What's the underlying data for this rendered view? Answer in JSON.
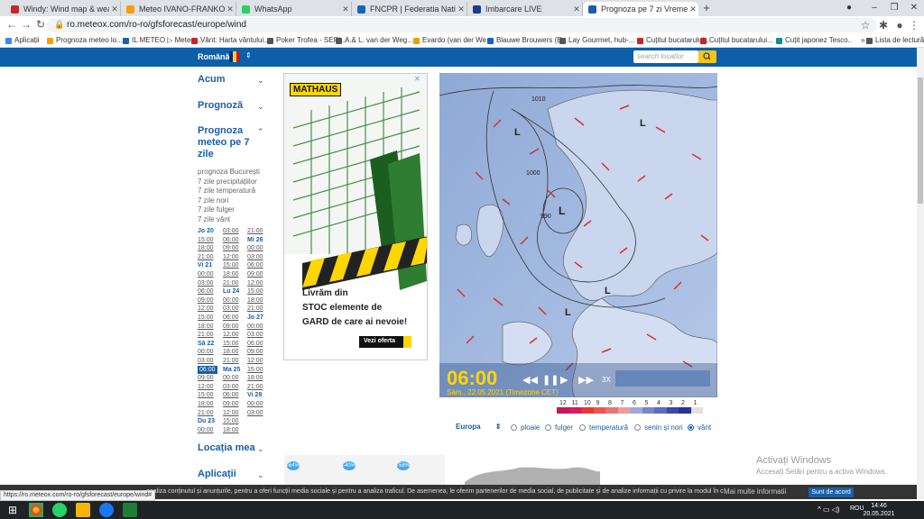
{
  "browser": {
    "tabs": [
      {
        "label": "Windy: Wind map & weather fo",
        "color": "#c62828",
        "active": false
      },
      {
        "label": "Meteo IVANO-FRANKOVSK (Ucra",
        "color": "#f59f00",
        "active": false
      },
      {
        "label": "WhatsApp",
        "color": "#25d366",
        "active": false
      },
      {
        "label": "FNCPR | Federatia Nationala a Cr",
        "color": "#1565c0",
        "active": false
      },
      {
        "label": "Imbarcare LIVE",
        "color": "#1e3a8a",
        "active": false
      },
      {
        "label": "Prognoza pe 7 zi Vremea Vânt p",
        "color": "#1a5ea8",
        "active": true
      }
    ],
    "url": "ro.meteox.com/ro-ro/gfsforecast/europe/wind",
    "bookmarks": [
      {
        "label": "Aplicații",
        "color": "#4285f4"
      },
      {
        "label": "Prognoza meteo lo...",
        "color": "#f59f00"
      },
      {
        "label": "IL METEO ▷ Meteo...",
        "color": "#1565c0"
      },
      {
        "label": "Vânt: Harta vântului...",
        "color": "#c62828"
      },
      {
        "label": "Poker Trofea - SERI...",
        "color": "#555555"
      },
      {
        "label": "A.& L. van der Weg...",
        "color": "#555555"
      },
      {
        "label": "Evardo (van der We...",
        "color": "#e8a000"
      },
      {
        "label": "Blauwe Brouwers (E...",
        "color": "#1565c0"
      },
      {
        "label": "Lay Gourmet, hub-...",
        "color": "#555555"
      },
      {
        "label": "Cuțitul bucatarului...",
        "color": "#c62828"
      },
      {
        "label": "Cuțitul bucatarului...",
        "color": "#c62828"
      },
      {
        "label": "Cuțit japonez Tesco...",
        "color": "#0d8f8f"
      },
      {
        "label": "»",
        "color": "#ffffff"
      },
      {
        "label": "Lista de lectură",
        "color": "#555555"
      }
    ]
  },
  "site": {
    "language": "Română",
    "search_placeholder": "search locatior",
    "sidebar": {
      "acum": "Acum",
      "prognoza": "Prognoză",
      "prognoza7_line1": "Prognoza",
      "prognoza7_line2": "meteo pe 7",
      "prognoza7_line3": "zile",
      "links": [
        "prognoza București",
        "7 zile precipitațiilor",
        "7 zile temperatură",
        "7 zile nori",
        "7 zile fulger",
        "7 zile vânt"
      ],
      "locatia": "Locația mea",
      "aplicatii": "Aplicații"
    },
    "hours": {
      "col1": [
        "Jo 20",
        "15:00",
        "18:00",
        "21:00",
        "Vi 21",
        "00:00",
        "03:00",
        "06:00",
        "09:00",
        "12:00",
        "15:00",
        "18:00",
        "21:00",
        "Sâ 22",
        "00:00",
        "03:00",
        "06:00",
        "09:00",
        "12:00",
        "15:00",
        "18:00",
        "21:00",
        "Du 23",
        "00:00"
      ],
      "col2": [
        "03:00",
        "06:00",
        "09:00",
        "12:00",
        "15:00",
        "18:00",
        "21:00",
        "Lu 24",
        "00:00",
        "03:00",
        "06:00",
        "09:00",
        "12:00",
        "15:00",
        "18:00",
        "21:00",
        "Ma 25",
        "00:00",
        "03:00",
        "06:00",
        "09:00",
        "12:00",
        "15:00",
        "18:00"
      ],
      "col3": [
        "21:00",
        "Mi 26",
        "00:00",
        "03:00",
        "06:00",
        "09:00",
        "12:00",
        "15:00",
        "18:00",
        "21:00",
        "Jo 27",
        "00:00",
        "03:00",
        "06:00",
        "09:00",
        "12:00",
        "15:00",
        "18:00",
        "21:00",
        "Vi 28",
        "00:00",
        "03:00",
        "",
        ""
      ],
      "selected": "06:00"
    },
    "ad": {
      "brand": "MATHAUS",
      "text_line1": "Livrăm din",
      "text_line2": "STOC elemente de",
      "text_line3": "GARD de care ai nevoie!",
      "cta": "Vezi oferta"
    },
    "map": {
      "time": "06:00",
      "date_line": "Sâm., 22.05.2021 (Timezone CET)",
      "zoom_label": "3X",
      "isobar_1010": "1010",
      "isobar_1000": "1000",
      "isobar_990": "990",
      "lows": [
        "L",
        "L",
        "L",
        "L",
        "L"
      ]
    },
    "legend": {
      "labels": [
        "12",
        "11",
        "10",
        "9",
        "8",
        "7",
        "6",
        "5",
        "4",
        "3",
        "2",
        "1"
      ],
      "colors": [
        "#c2185b",
        "#d81b60",
        "#e53935",
        "#ef5350",
        "#e57373",
        "#ef9a9a",
        "#9fa8da",
        "#7986cb",
        "#5c6bc0",
        "#3949ab",
        "#283593",
        "#e0e0e0"
      ]
    },
    "region": "Europa",
    "layers": [
      {
        "label": "ploaie",
        "checked": false
      },
      {
        "label": "fulger",
        "checked": false
      },
      {
        "label": "temperatură",
        "checked": false
      },
      {
        "label": "senin și nori",
        "checked": false
      },
      {
        "label": "vânt",
        "checked": true
      }
    ]
  },
  "overlay": {
    "windows_line1": "Activați Windows",
    "windows_line2": "Accesați Setări pentru a activa Windows.",
    "status_url": "https://ro.meteox.com/ro-ro/gfsforecast/europe/wind#",
    "cookie_text": "analiza conținutul și anunțurile, pentru a oferi funcții media sociale și pentru a analiza traficul. De asemenea, le oferim partenerilor de media social, de publicitate și de analize informații cu privire la modul în care folosiți site-ul nostru.",
    "cookie_more": "Mai multe informatii",
    "cookie_accept": "Sunt de acord",
    "clock_time": "14:46",
    "clock_date": "20.05.2021",
    "lang": "ROU"
  },
  "promo_badges": [
    "-64%",
    "-40%",
    "-58%"
  ]
}
